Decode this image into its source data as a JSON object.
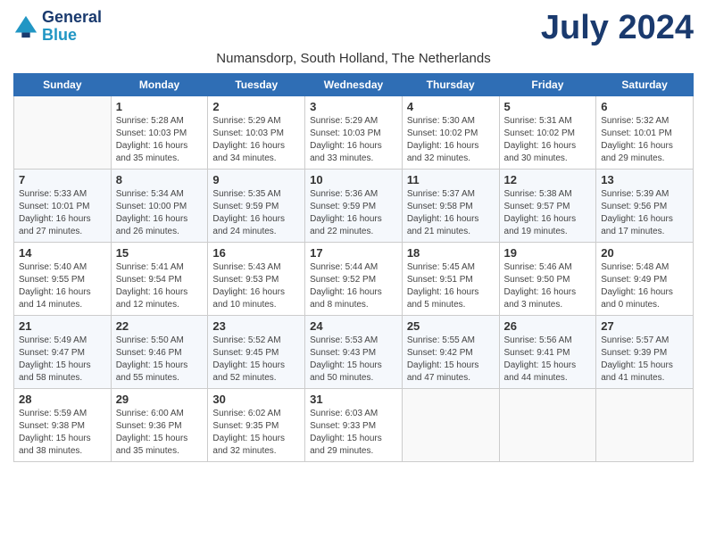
{
  "header": {
    "logo_line1": "General",
    "logo_line2": "Blue",
    "month_year": "July 2024",
    "location": "Numansdorp, South Holland, The Netherlands"
  },
  "weekdays": [
    "Sunday",
    "Monday",
    "Tuesday",
    "Wednesday",
    "Thursday",
    "Friday",
    "Saturday"
  ],
  "weeks": [
    [
      {
        "day": "",
        "info": ""
      },
      {
        "day": "1",
        "info": "Sunrise: 5:28 AM\nSunset: 10:03 PM\nDaylight: 16 hours\nand 35 minutes."
      },
      {
        "day": "2",
        "info": "Sunrise: 5:29 AM\nSunset: 10:03 PM\nDaylight: 16 hours\nand 34 minutes."
      },
      {
        "day": "3",
        "info": "Sunrise: 5:29 AM\nSunset: 10:03 PM\nDaylight: 16 hours\nand 33 minutes."
      },
      {
        "day": "4",
        "info": "Sunrise: 5:30 AM\nSunset: 10:02 PM\nDaylight: 16 hours\nand 32 minutes."
      },
      {
        "day": "5",
        "info": "Sunrise: 5:31 AM\nSunset: 10:02 PM\nDaylight: 16 hours\nand 30 minutes."
      },
      {
        "day": "6",
        "info": "Sunrise: 5:32 AM\nSunset: 10:01 PM\nDaylight: 16 hours\nand 29 minutes."
      }
    ],
    [
      {
        "day": "7",
        "info": "Sunrise: 5:33 AM\nSunset: 10:01 PM\nDaylight: 16 hours\nand 27 minutes."
      },
      {
        "day": "8",
        "info": "Sunrise: 5:34 AM\nSunset: 10:00 PM\nDaylight: 16 hours\nand 26 minutes."
      },
      {
        "day": "9",
        "info": "Sunrise: 5:35 AM\nSunset: 9:59 PM\nDaylight: 16 hours\nand 24 minutes."
      },
      {
        "day": "10",
        "info": "Sunrise: 5:36 AM\nSunset: 9:59 PM\nDaylight: 16 hours\nand 22 minutes."
      },
      {
        "day": "11",
        "info": "Sunrise: 5:37 AM\nSunset: 9:58 PM\nDaylight: 16 hours\nand 21 minutes."
      },
      {
        "day": "12",
        "info": "Sunrise: 5:38 AM\nSunset: 9:57 PM\nDaylight: 16 hours\nand 19 minutes."
      },
      {
        "day": "13",
        "info": "Sunrise: 5:39 AM\nSunset: 9:56 PM\nDaylight: 16 hours\nand 17 minutes."
      }
    ],
    [
      {
        "day": "14",
        "info": "Sunrise: 5:40 AM\nSunset: 9:55 PM\nDaylight: 16 hours\nand 14 minutes."
      },
      {
        "day": "15",
        "info": "Sunrise: 5:41 AM\nSunset: 9:54 PM\nDaylight: 16 hours\nand 12 minutes."
      },
      {
        "day": "16",
        "info": "Sunrise: 5:43 AM\nSunset: 9:53 PM\nDaylight: 16 hours\nand 10 minutes."
      },
      {
        "day": "17",
        "info": "Sunrise: 5:44 AM\nSunset: 9:52 PM\nDaylight: 16 hours\nand 8 minutes."
      },
      {
        "day": "18",
        "info": "Sunrise: 5:45 AM\nSunset: 9:51 PM\nDaylight: 16 hours\nand 5 minutes."
      },
      {
        "day": "19",
        "info": "Sunrise: 5:46 AM\nSunset: 9:50 PM\nDaylight: 16 hours\nand 3 minutes."
      },
      {
        "day": "20",
        "info": "Sunrise: 5:48 AM\nSunset: 9:49 PM\nDaylight: 16 hours\nand 0 minutes."
      }
    ],
    [
      {
        "day": "21",
        "info": "Sunrise: 5:49 AM\nSunset: 9:47 PM\nDaylight: 15 hours\nand 58 minutes."
      },
      {
        "day": "22",
        "info": "Sunrise: 5:50 AM\nSunset: 9:46 PM\nDaylight: 15 hours\nand 55 minutes."
      },
      {
        "day": "23",
        "info": "Sunrise: 5:52 AM\nSunset: 9:45 PM\nDaylight: 15 hours\nand 52 minutes."
      },
      {
        "day": "24",
        "info": "Sunrise: 5:53 AM\nSunset: 9:43 PM\nDaylight: 15 hours\nand 50 minutes."
      },
      {
        "day": "25",
        "info": "Sunrise: 5:55 AM\nSunset: 9:42 PM\nDaylight: 15 hours\nand 47 minutes."
      },
      {
        "day": "26",
        "info": "Sunrise: 5:56 AM\nSunset: 9:41 PM\nDaylight: 15 hours\nand 44 minutes."
      },
      {
        "day": "27",
        "info": "Sunrise: 5:57 AM\nSunset: 9:39 PM\nDaylight: 15 hours\nand 41 minutes."
      }
    ],
    [
      {
        "day": "28",
        "info": "Sunrise: 5:59 AM\nSunset: 9:38 PM\nDaylight: 15 hours\nand 38 minutes."
      },
      {
        "day": "29",
        "info": "Sunrise: 6:00 AM\nSunset: 9:36 PM\nDaylight: 15 hours\nand 35 minutes."
      },
      {
        "day": "30",
        "info": "Sunrise: 6:02 AM\nSunset: 9:35 PM\nDaylight: 15 hours\nand 32 minutes."
      },
      {
        "day": "31",
        "info": "Sunrise: 6:03 AM\nSunset: 9:33 PM\nDaylight: 15 hours\nand 29 minutes."
      },
      {
        "day": "",
        "info": ""
      },
      {
        "day": "",
        "info": ""
      },
      {
        "day": "",
        "info": ""
      }
    ]
  ]
}
